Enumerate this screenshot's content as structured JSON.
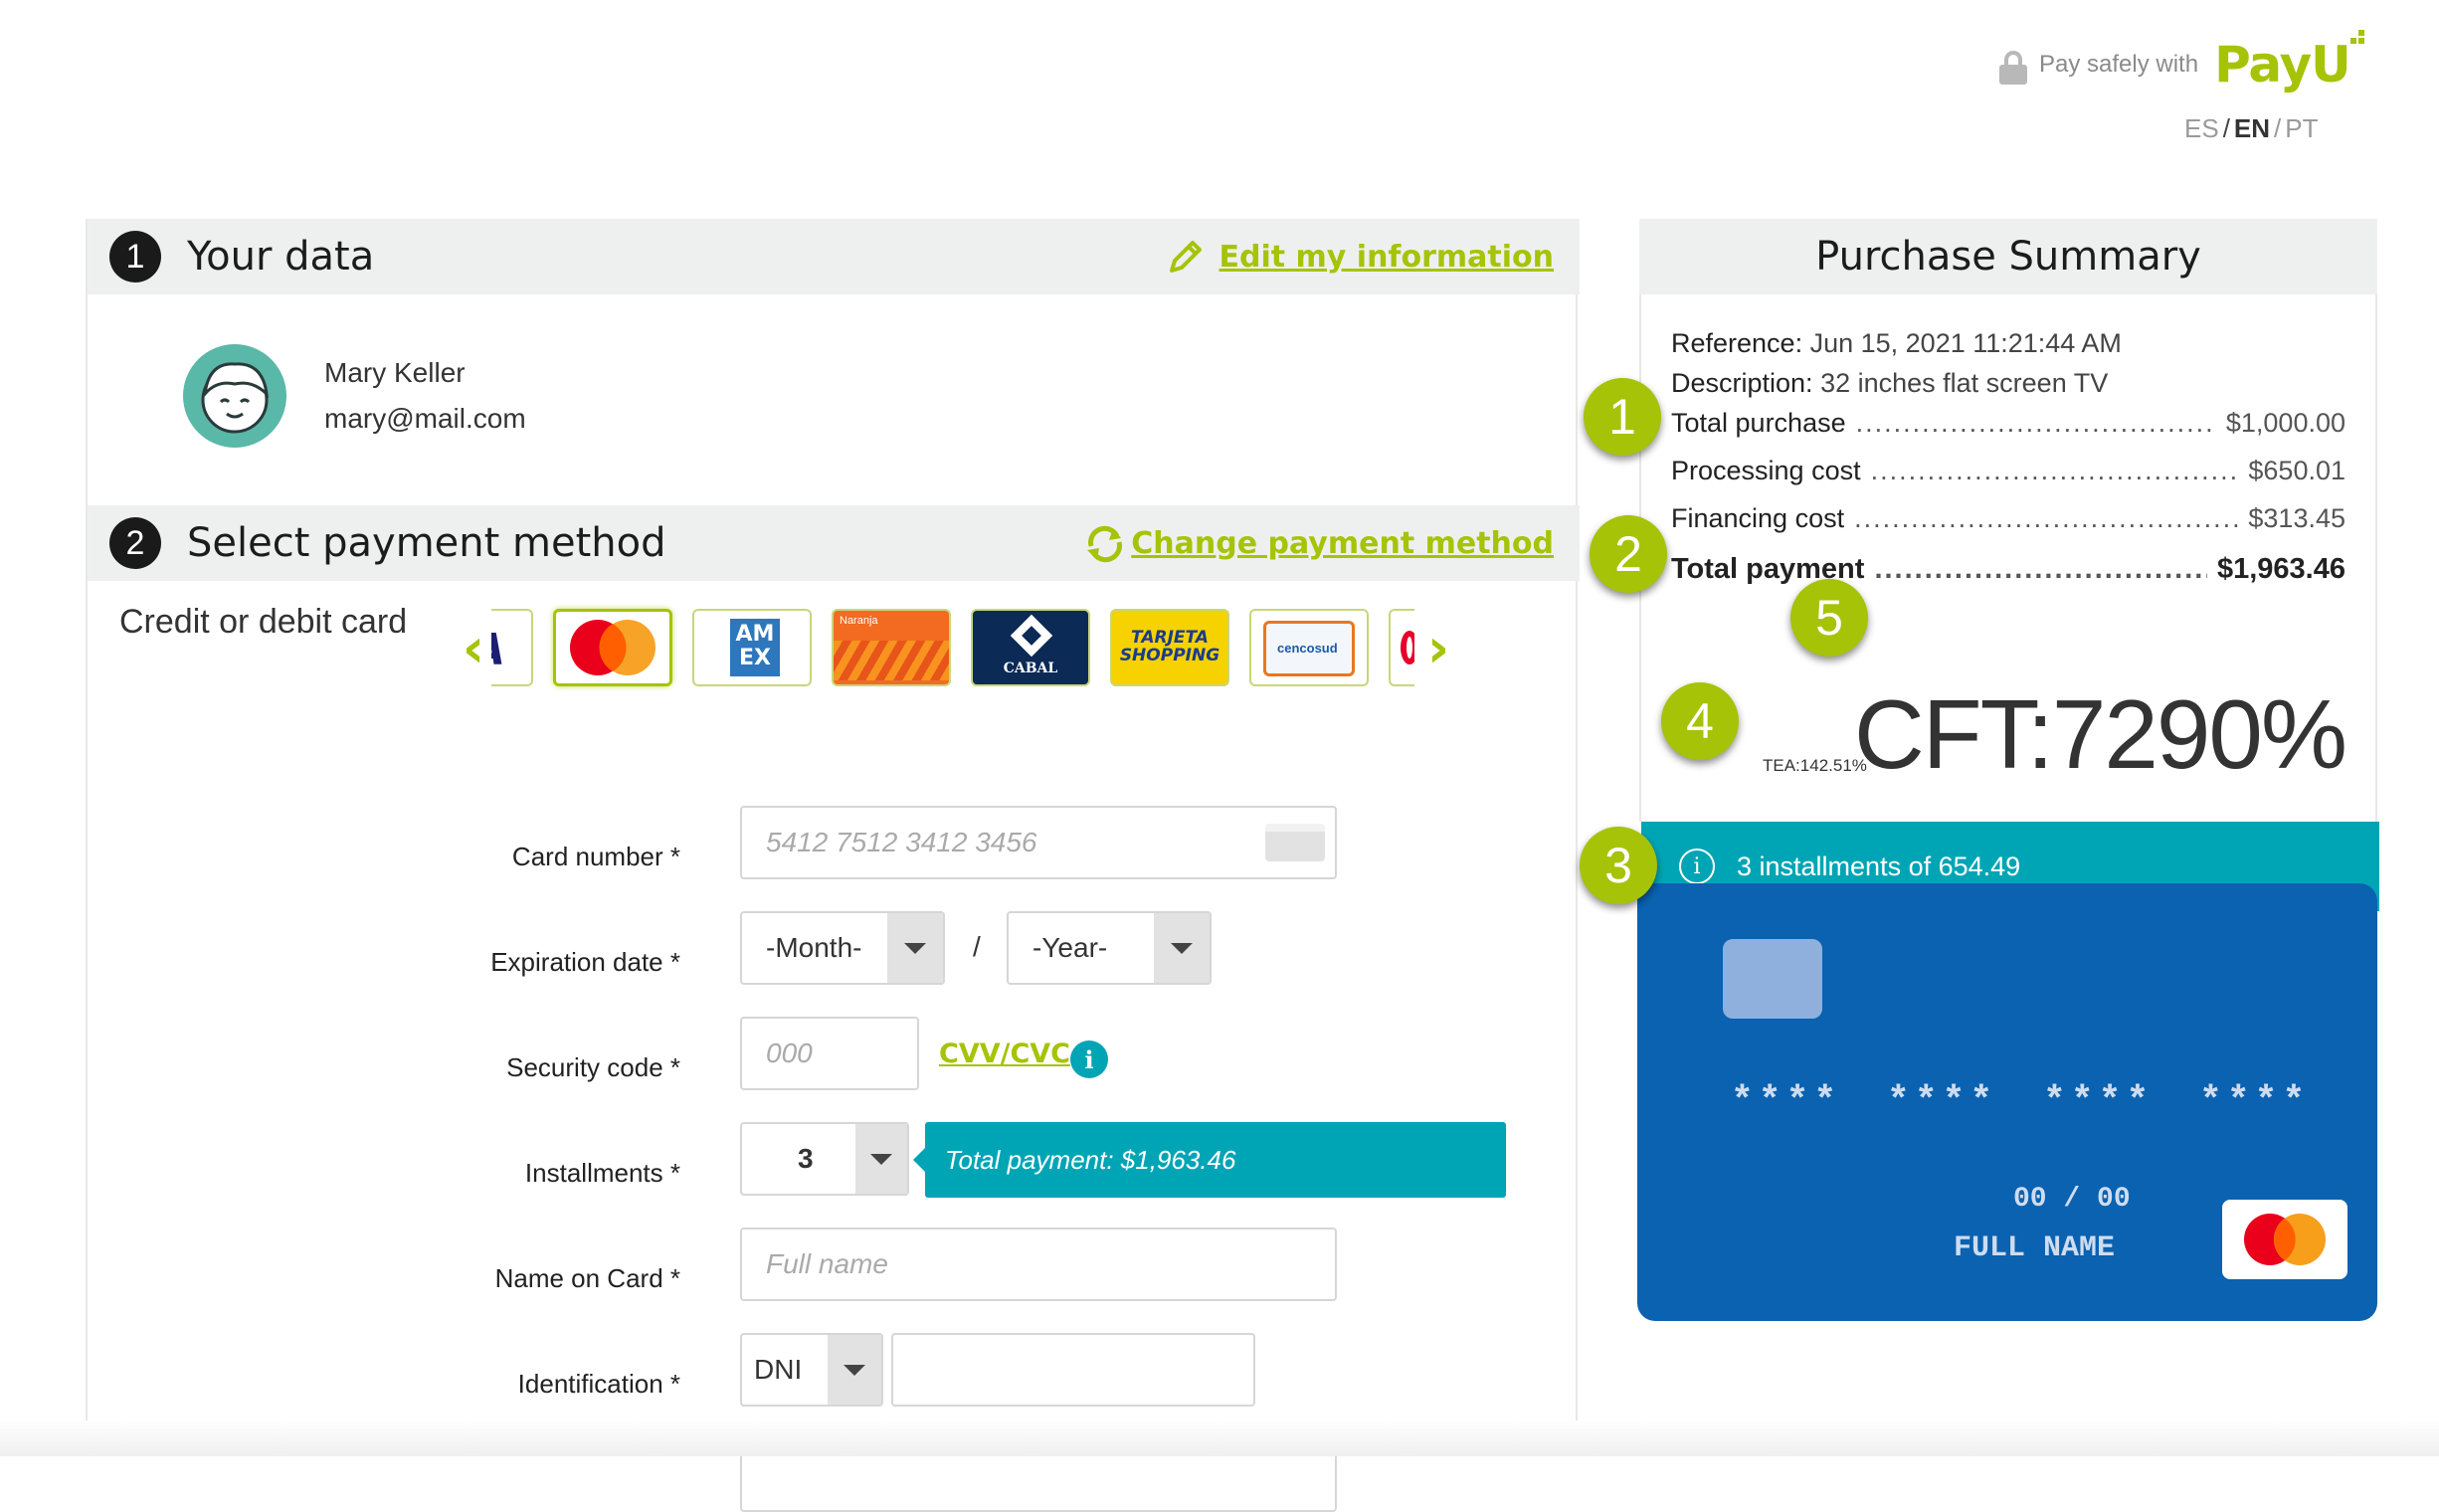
{
  "header": {
    "pay_safely_text": "Pay safely with",
    "brand_logo": "PayU",
    "languages": [
      "ES",
      "EN",
      "PT"
    ],
    "active_language": "EN"
  },
  "your_data": {
    "step": "1",
    "title": "Your data",
    "edit_link": "Edit my information",
    "name": "Mary Keller",
    "email": "mary@mail.com"
  },
  "payment": {
    "step": "2",
    "title": "Select payment method",
    "change_link": "Change payment method",
    "method_label": "Credit or debit card",
    "cards": [
      "visa",
      "mastercard",
      "amex",
      "naranja",
      "cabal",
      "tarjeta-shopping",
      "cencosud",
      "other"
    ],
    "selected_card": "mastercard"
  },
  "form": {
    "card_number_label": "Card number *",
    "card_number_placeholder": "5412 7512 3412 3456",
    "expiration_label": "Expiration date *",
    "month_value": "-Month-",
    "year_value": "-Year-",
    "slash": "/",
    "security_label": "Security code *",
    "security_placeholder": "000",
    "cvv_link": "CVV/CVC",
    "installments_label": "Installments *",
    "installments_value": "3",
    "installments_total": "Total payment: $1,963.46",
    "name_label": "Name on Card *",
    "name_placeholder": "Full name",
    "id_label": "Identification *",
    "id_type": "DNI"
  },
  "summary": {
    "title": "Purchase Summary",
    "reference_label": "Reference:",
    "reference_value": "Jun 15, 2021 11:21:44 AM",
    "description_label": "Description:",
    "description_value": "32 inches flat screen TV",
    "rows": [
      {
        "label": "Total purchase",
        "value": "$1,000.00"
      },
      {
        "label": "Processing cost",
        "value": "$650.01"
      },
      {
        "label": "Financing cost",
        "value": "$313.45"
      }
    ],
    "total_label": "Total payment",
    "total_value": "$1,963.46",
    "tea": "TEA:142.51%",
    "cft": "CFT:7290%",
    "installments_text": "3 installments of 654.49",
    "markers": [
      "1",
      "2",
      "3",
      "4",
      "5"
    ]
  },
  "card_preview": {
    "number": "**** **** **** ****",
    "expiry": "00 / 00",
    "holder": "FULL NAME"
  },
  "colors": {
    "accent_green": "#a6c307",
    "teal": "#00a5b5",
    "card_blue": "#0a62b0"
  }
}
